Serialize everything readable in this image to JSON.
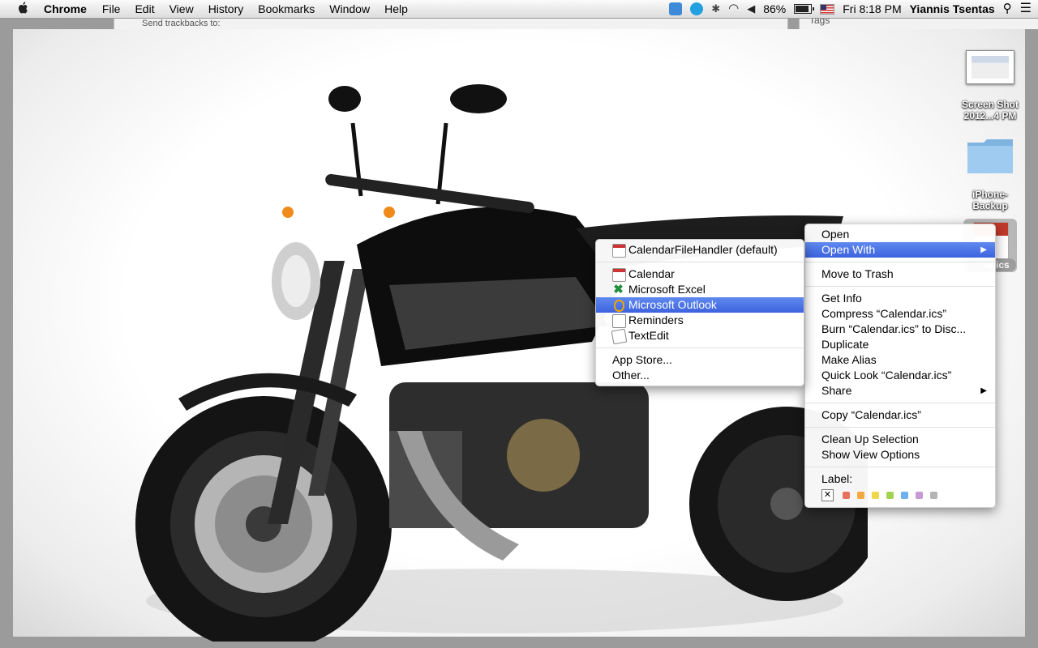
{
  "menubar": {
    "app_name": "Chrome",
    "menus": [
      "File",
      "Edit",
      "View",
      "History",
      "Bookmarks",
      "Window",
      "Help"
    ],
    "battery_percent": "86%",
    "battery_level": 0.86,
    "clock": "Fri 8:18 PM",
    "user": "Yiannis Tsentas"
  },
  "background_window": {
    "text": "Send trackbacks to:",
    "right_text": "Tags"
  },
  "desktop_icons": {
    "screenshot": {
      "line1": "Screen Shot",
      "line2": "2012...4 PM"
    },
    "folder": {
      "line1": "iPhone-",
      "line2": "Backup"
    },
    "calendar_file": {
      "label": "ar.ics"
    }
  },
  "context_menu": {
    "items": [
      {
        "label": "Open"
      },
      {
        "label": "Open With"
      },
      {
        "label": "Move to Trash"
      },
      {
        "label": "Get Info"
      },
      {
        "label": "Compress “Calendar.ics”"
      },
      {
        "label": "Burn “Calendar.ics” to Disc..."
      },
      {
        "label": "Duplicate"
      },
      {
        "label": "Make Alias"
      },
      {
        "label": "Quick Look “Calendar.ics”"
      },
      {
        "label": "Share"
      },
      {
        "label": "Copy “Calendar.ics”"
      },
      {
        "label": "Clean Up Selection"
      },
      {
        "label": "Show View Options"
      },
      {
        "label": "Label:"
      }
    ],
    "label_colors": [
      "#e8715e",
      "#f3a842",
      "#f1d84a",
      "#a4d353",
      "#6cb0f0",
      "#c69ad6",
      "#b4b4b4"
    ]
  },
  "open_with_menu": {
    "default_app": "CalendarFileHandler (default)",
    "apps": [
      "Calendar",
      "Microsoft Excel",
      "Microsoft Outlook",
      "Reminders",
      "TextEdit"
    ],
    "app_store": "App Store...",
    "other": "Other..."
  }
}
